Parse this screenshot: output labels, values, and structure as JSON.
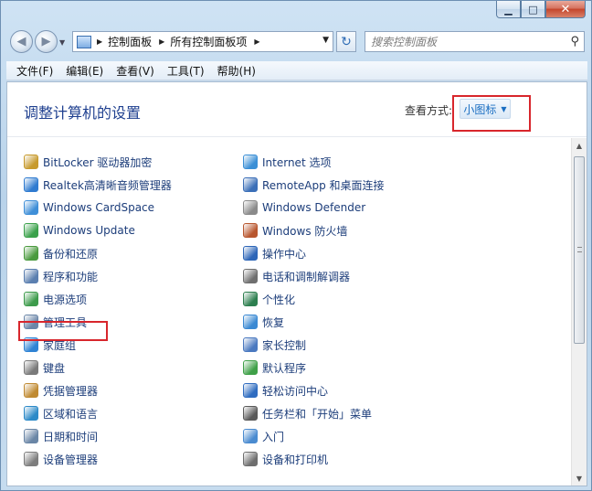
{
  "window": {
    "caption": {
      "minimize": "▁",
      "maximize": "□",
      "close": "✕"
    }
  },
  "nav": {
    "back": "◀",
    "forward": "▶",
    "recent": "▼",
    "breadcrumbs": [
      "控制面板",
      "所有控制面板项"
    ],
    "addr_drop": "▼",
    "refresh": "↻",
    "search_placeholder": "搜索控制面板",
    "search_icon": "magnifier-icon"
  },
  "menu": [
    "文件(F)",
    "编辑(E)",
    "查看(V)",
    "工具(T)",
    "帮助(H)"
  ],
  "header": {
    "title": "调整计算机的设置",
    "view_label": "查看方式:",
    "view_value": "小图标"
  },
  "items_left": [
    {
      "label": "BitLocker 驱动器加密",
      "icon": "bitlocker-icon",
      "color": "#c79a2c"
    },
    {
      "label": "Realtek高清晰音频管理器",
      "icon": "realtek-audio-icon",
      "color": "#2f7bd0"
    },
    {
      "label": "Windows CardSpace",
      "icon": "cardspace-icon",
      "color": "#3f8fd8"
    },
    {
      "label": "Windows Update",
      "icon": "windows-update-icon",
      "color": "#3aa14a"
    },
    {
      "label": "备份和还原",
      "icon": "backup-icon",
      "color": "#4a9a3e"
    },
    {
      "label": "程序和功能",
      "icon": "programs-icon",
      "color": "#5b7fb0"
    },
    {
      "label": "电源选项",
      "icon": "power-icon",
      "color": "#3d9b4b"
    },
    {
      "label": "管理工具",
      "icon": "admin-tools-icon",
      "color": "#6b86a8"
    },
    {
      "label": "家庭组",
      "icon": "homegroup-icon",
      "color": "#2f83d4"
    },
    {
      "label": "键盘",
      "icon": "keyboard-icon",
      "color": "#7a7a7a"
    },
    {
      "label": "凭据管理器",
      "icon": "credential-icon",
      "color": "#c08a32"
    },
    {
      "label": "区域和语言",
      "icon": "region-icon",
      "color": "#2c8ac8"
    },
    {
      "label": "日期和时间",
      "icon": "clock-icon",
      "color": "#6a86a6"
    },
    {
      "label": "设备管理器",
      "icon": "device-manager-icon",
      "color": "#7d7d7d"
    }
  ],
  "items_right": [
    {
      "label": "Internet 选项",
      "icon": "internet-options-icon",
      "color": "#3a8fd6"
    },
    {
      "label": "RemoteApp 和桌面连接",
      "icon": "remoteapp-icon",
      "color": "#3b6fb8"
    },
    {
      "label": "Windows Defender",
      "icon": "defender-icon",
      "color": "#8a8a8a"
    },
    {
      "label": "Windows 防火墙",
      "icon": "firewall-icon",
      "color": "#b8562e"
    },
    {
      "label": "操作中心",
      "icon": "action-center-icon",
      "color": "#2d66b8"
    },
    {
      "label": "电话和调制解调器",
      "icon": "phone-modem-icon",
      "color": "#6f6f6f"
    },
    {
      "label": "个性化",
      "icon": "personalization-icon",
      "color": "#2d7f4f"
    },
    {
      "label": "恢复",
      "icon": "recovery-icon",
      "color": "#3a89d3"
    },
    {
      "label": "家长控制",
      "icon": "parental-control-icon",
      "color": "#4a79c0"
    },
    {
      "label": "默认程序",
      "icon": "default-programs-icon",
      "color": "#3fa048"
    },
    {
      "label": "轻松访问中心",
      "icon": "ease-of-access-icon",
      "color": "#2f6cc0"
    },
    {
      "label": "任务栏和「开始」菜单",
      "icon": "taskbar-icon",
      "color": "#5a5a5a"
    },
    {
      "label": "入门",
      "icon": "getting-started-icon",
      "color": "#4a8bd0"
    },
    {
      "label": "设备和打印机",
      "icon": "printer-icon",
      "color": "#6e6e6e"
    }
  ],
  "highlight_color": "#d8262c"
}
